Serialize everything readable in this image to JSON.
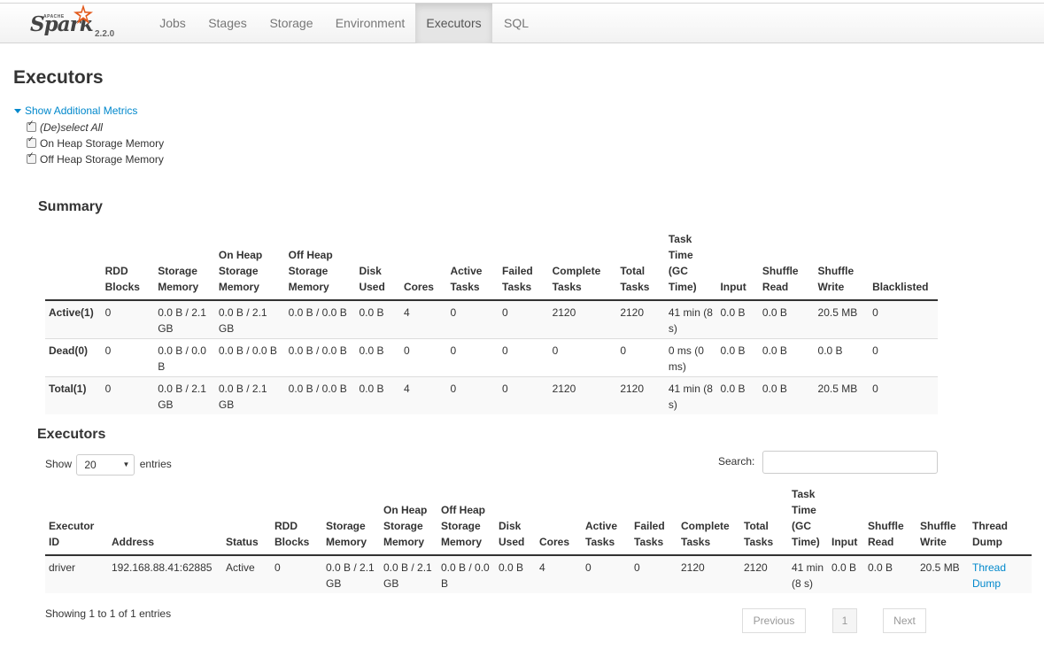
{
  "brand": {
    "name": "Spark",
    "super": "APACHE",
    "version": "2.2.0"
  },
  "nav": [
    "Jobs",
    "Stages",
    "Storage",
    "Environment",
    "Executors",
    "SQL"
  ],
  "page_title": "Executors",
  "metrics": {
    "toggle_label": "Show Additional Metrics",
    "options": [
      "(De)select All",
      "On Heap Storage Memory",
      "Off Heap Storage Memory"
    ]
  },
  "summary": {
    "title": "Summary",
    "headers": [
      "",
      "RDD Blocks",
      "Storage Memory",
      "On Heap Storage Memory",
      "Off Heap Storage Memory",
      "Disk Used",
      "Cores",
      "Active Tasks",
      "Failed Tasks",
      "Complete Tasks",
      "Total Tasks",
      "Task Time (GC Time)",
      "Input",
      "Shuffle Read",
      "Shuffle Write",
      "Blacklisted"
    ],
    "rows": [
      [
        "Active(1)",
        "0",
        "0.0 B / 2.1 GB",
        "0.0 B / 2.1 GB",
        "0.0 B / 0.0 B",
        "0.0 B",
        "4",
        "0",
        "0",
        "2120",
        "2120",
        "41 min (8 s)",
        "0.0 B",
        "0.0 B",
        "20.5 MB",
        "0"
      ],
      [
        "Dead(0)",
        "0",
        "0.0 B / 0.0 B",
        "0.0 B / 0.0 B",
        "0.0 B / 0.0 B",
        "0.0 B",
        "0",
        "0",
        "0",
        "0",
        "0",
        "0 ms (0 ms)",
        "0.0 B",
        "0.0 B",
        "0.0 B",
        "0"
      ],
      [
        "Total(1)",
        "0",
        "0.0 B / 2.1 GB",
        "0.0 B / 2.1 GB",
        "0.0 B / 0.0 B",
        "0.0 B",
        "4",
        "0",
        "0",
        "2120",
        "2120",
        "41 min (8 s)",
        "0.0 B",
        "0.0 B",
        "20.5 MB",
        "0"
      ]
    ]
  },
  "executors": {
    "title": "Executors",
    "show_label": "Show",
    "page_size": "20",
    "entries_label": "entries",
    "search_label": "Search:",
    "headers": [
      "Executor ID",
      "Address",
      "Status",
      "RDD Blocks",
      "Storage Memory",
      "On Heap Storage Memory",
      "Off Heap Storage Memory",
      "Disk Used",
      "Cores",
      "Active Tasks",
      "Failed Tasks",
      "Complete Tasks",
      "Total Tasks",
      "Task Time (GC Time)",
      "Input",
      "Shuffle Read",
      "Shuffle Write",
      "Thread Dump"
    ],
    "rows": [
      [
        "driver",
        "192.168.88.41:62885",
        "Active",
        "0",
        "0.0 B / 2.1 GB",
        "0.0 B / 2.1 GB",
        "0.0 B / 0.0 B",
        "0.0 B",
        "4",
        "0",
        "0",
        "2120",
        "2120",
        "41 min (8 s)",
        "0.0 B",
        "0.0 B",
        "20.5 MB",
        "Thread Dump"
      ]
    ],
    "info": "Showing 1 to 1 of 1 entries",
    "pagination": {
      "previous": "Previous",
      "current": "1",
      "next": "Next"
    }
  },
  "colors": {
    "link": "#0088cc",
    "active_tab_bg": "#e5e5e5",
    "star": "#e25a1c"
  },
  "icons": {
    "logo": "spark-star-icon",
    "toggle": "caret-down-icon",
    "select": "chevron-down-icon"
  }
}
